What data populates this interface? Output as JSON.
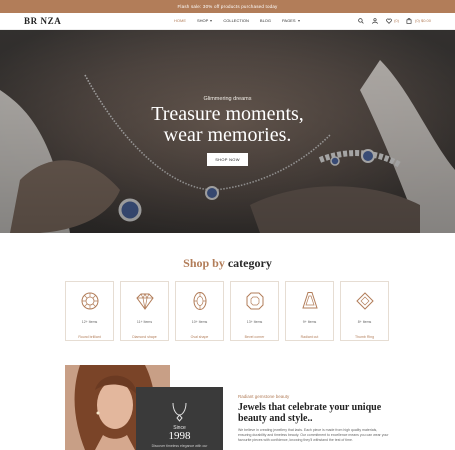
{
  "promo": {
    "text": "Flash sale: 30% off products purchased today"
  },
  "brand": {
    "logo": "BR NZA"
  },
  "nav": {
    "items": [
      {
        "label": "HOME",
        "active": true,
        "dropdown": false
      },
      {
        "label": "SHOP",
        "active": false,
        "dropdown": true
      },
      {
        "label": "COLLECTION",
        "active": false,
        "dropdown": false
      },
      {
        "label": "BLOG",
        "active": false,
        "dropdown": false
      },
      {
        "label": "PAGES",
        "active": false,
        "dropdown": true
      }
    ],
    "icons": [
      "search-icon",
      "user-icon",
      "heart-icon",
      "cart-icon"
    ],
    "wishlist_count": "(0)",
    "cart_total": "(0) $0.00"
  },
  "hero": {
    "kicker": "Glimmering dreams",
    "title_line1": "Treasure moments,",
    "title_line2": "wear memories.",
    "button": "SHOP NOW"
  },
  "categories": {
    "title_accent": "Shop by",
    "title_rest": "category",
    "items": [
      {
        "count": "12+ Items",
        "name": "Round brilliant",
        "icon": "round-gem-icon"
      },
      {
        "count": "11+ Items",
        "name": "Diamond shape",
        "icon": "diamond-icon"
      },
      {
        "count": "10+ Items",
        "name": "Oval shape",
        "icon": "oval-gem-icon"
      },
      {
        "count": "13+ Items",
        "name": "Bevel corner",
        "icon": "octagon-gem-icon"
      },
      {
        "count": "9+ Items",
        "name": "Radiant cut",
        "icon": "radiant-gem-icon"
      },
      {
        "count": "8+ Items",
        "name": "Thumb Ring",
        "icon": "kite-gem-icon"
      }
    ]
  },
  "about": {
    "badge_since": "Since",
    "badge_year": "1998",
    "badge_sub": "Discover timeless elegance with our",
    "kicker": "Radiant gemstone beauty",
    "title": "Jewels that celebrate your unique beauty and style..",
    "text": "We believe in creating jewellery that lasts. Each piece is made from high quality materials, ensuring durability and timeless beauty. Our commitment to excellence means you can wear your favourite pieces with confidence, knowing they'll withstand the test of time."
  },
  "colors": {
    "accent": "#b27d59",
    "dark": "#222222",
    "badge": "#3a3a3a"
  }
}
